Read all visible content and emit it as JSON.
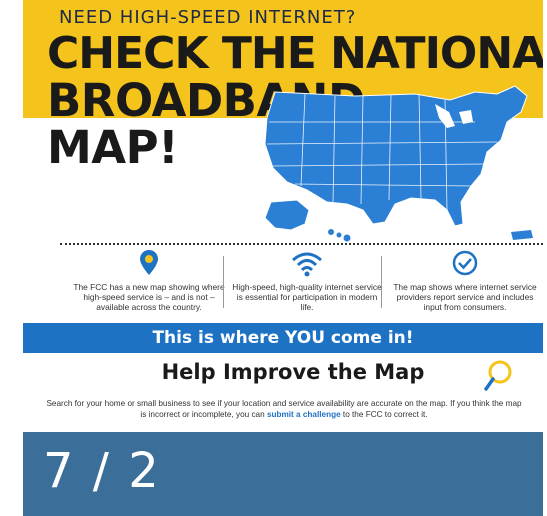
{
  "poster": {
    "kicker": "NEED HIGH-SPEED INTERNET?",
    "headline_lines": [
      "CHECK THE NATIONAL",
      "BROADBAND",
      "MAP!"
    ],
    "features": [
      {
        "icon": "location-pin-icon",
        "text": "The FCC has a new map showing where high-speed service is – and is not – available across the country."
      },
      {
        "icon": "wifi-icon",
        "text": "High-speed, high-quality internet service is essential for participation in modern life."
      },
      {
        "icon": "checkmark-circle-icon",
        "text": "The map shows where internet service providers report service and includes input from consumers."
      }
    ],
    "banner": "This is where YOU come in!",
    "help_title": "Help Improve the Map",
    "description_before": "Search for your home or small business to see if your location and service availability are accurate on the map. If you think the map is incorrect or incomplete, you can ",
    "description_link": "submit a challenge",
    "description_after": " to the FCC to correct it."
  },
  "counter": {
    "text": "7 / 2"
  },
  "colors": {
    "yellow": "#f4c31c",
    "blue": "#1e72c4",
    "map_blue": "#2b7fd4",
    "counter_bar": "#3b6e99",
    "dark": "#1a1a1a"
  }
}
